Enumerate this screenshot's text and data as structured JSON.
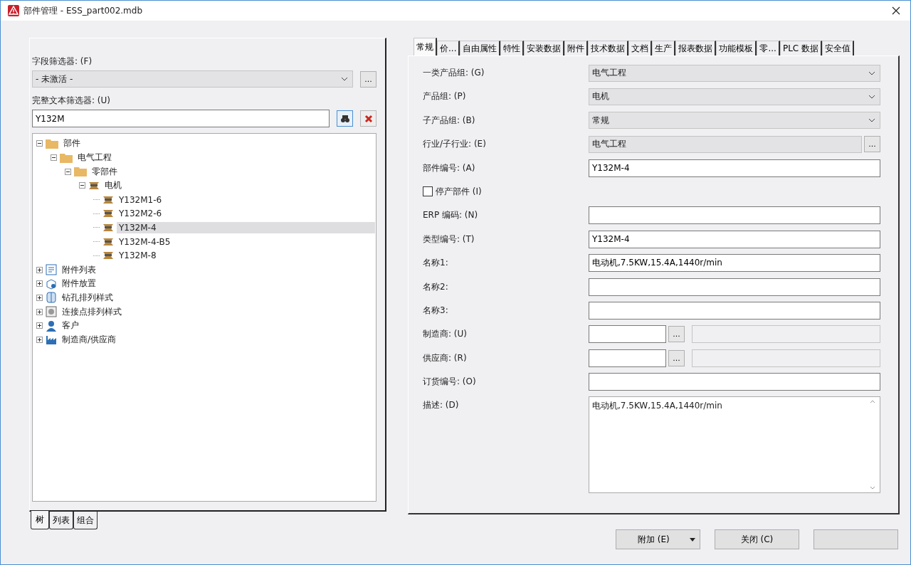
{
  "window": {
    "title": "部件管理 - ESS_part002.mdb"
  },
  "left": {
    "field_filter": {
      "label": "字段筛选器: (F)",
      "value": "- 未激活 -",
      "button": "..."
    },
    "text_filter": {
      "label": "完整文本筛选器: (U)",
      "value": "Y132M"
    },
    "tree": [
      {
        "label": "部件",
        "kind": "folder",
        "expanded": true,
        "selected": false,
        "children": [
          {
            "label": "电气工程",
            "kind": "folder",
            "expanded": true,
            "selected": false,
            "children": [
              {
                "label": "零部件",
                "kind": "folder",
                "expanded": true,
                "selected": false,
                "children": [
                  {
                    "label": "电机",
                    "kind": "motor",
                    "expanded": true,
                    "selected": false,
                    "children": [
                      {
                        "label": "Y132M1-6",
                        "kind": "motor",
                        "selected": false
                      },
                      {
                        "label": "Y132M2-6",
                        "kind": "motor",
                        "selected": false
                      },
                      {
                        "label": "Y132M-4",
                        "kind": "motor",
                        "selected": true
                      },
                      {
                        "label": "Y132M-4-B5",
                        "kind": "motor",
                        "selected": false
                      },
                      {
                        "label": "Y132M-8",
                        "kind": "motor",
                        "selected": false
                      }
                    ]
                  }
                ]
              }
            ]
          }
        ]
      },
      {
        "label": "附件列表",
        "kind": "list",
        "expanded": false,
        "selected": false
      },
      {
        "label": "附件放置",
        "kind": "placement",
        "expanded": false,
        "selected": false
      },
      {
        "label": "钻孔排列样式",
        "kind": "drill",
        "expanded": false,
        "selected": false
      },
      {
        "label": "连接点排列样式",
        "kind": "connection",
        "expanded": false,
        "selected": false
      },
      {
        "label": "客户",
        "kind": "person",
        "expanded": false,
        "selected": false
      },
      {
        "label": "制造商/供应商",
        "kind": "factory",
        "expanded": false,
        "selected": false
      }
    ],
    "tabs": [
      {
        "label": "树",
        "selected": true
      },
      {
        "label": "列表",
        "selected": false
      },
      {
        "label": "组合",
        "selected": false
      }
    ]
  },
  "right": {
    "tabs": [
      {
        "label": "常规",
        "selected": true
      },
      {
        "label": "价...",
        "selected": false
      },
      {
        "label": "自由属性",
        "selected": false
      },
      {
        "label": "特性",
        "selected": false
      },
      {
        "label": "安装数据",
        "selected": false
      },
      {
        "label": "附件",
        "selected": false
      },
      {
        "label": "技术数据",
        "selected": false
      },
      {
        "label": "文档",
        "selected": false
      },
      {
        "label": "生产",
        "selected": false
      },
      {
        "label": "报表数据",
        "selected": false
      },
      {
        "label": "功能模板",
        "selected": false
      },
      {
        "label": "零...",
        "selected": false
      },
      {
        "label": "PLC 数据",
        "selected": false
      },
      {
        "label": "安全值",
        "selected": false
      }
    ],
    "fields": [
      {
        "kind": "select",
        "label": "一类产品组: (G)",
        "value": "电气工程"
      },
      {
        "kind": "select",
        "label": "产品组: (P)",
        "value": "电机"
      },
      {
        "kind": "select",
        "label": "子产品组: (B)",
        "value": "常规"
      },
      {
        "kind": "browse",
        "label": "行业/子行业: (E)",
        "value": "电气工程",
        "button": "..."
      },
      {
        "kind": "text",
        "label": "部件编号: (A)",
        "value": "Y132M-4"
      },
      {
        "kind": "checkbox",
        "label": "停产部件 (I)",
        "checked": false
      },
      {
        "kind": "text",
        "label": "ERP 编码: (N)"
      },
      {
        "kind": "text",
        "label": "类型编号: (T)",
        "value": "Y132M-4"
      },
      {
        "kind": "text",
        "label": "名称1:",
        "value": "电动机,7.5KW,15.4A,1440r/min"
      },
      {
        "kind": "text",
        "label": "名称2:"
      },
      {
        "kind": "text",
        "label": "名称3:"
      },
      {
        "kind": "lookup",
        "label": "制造商: (U)",
        "button": "..."
      },
      {
        "kind": "lookup",
        "label": "供应商: (R)",
        "button": "..."
      },
      {
        "kind": "text",
        "label": "订货编号: (O)"
      },
      {
        "kind": "textarea",
        "label": "描述: (D)",
        "value": "电动机,7.5KW,15.4A,1440r/min"
      }
    ]
  },
  "buttons": [
    {
      "kind": "split",
      "label": "附加 (E)"
    },
    {
      "kind": "plain",
      "label": "关闭 (C)"
    },
    {
      "kind": "covered"
    }
  ]
}
